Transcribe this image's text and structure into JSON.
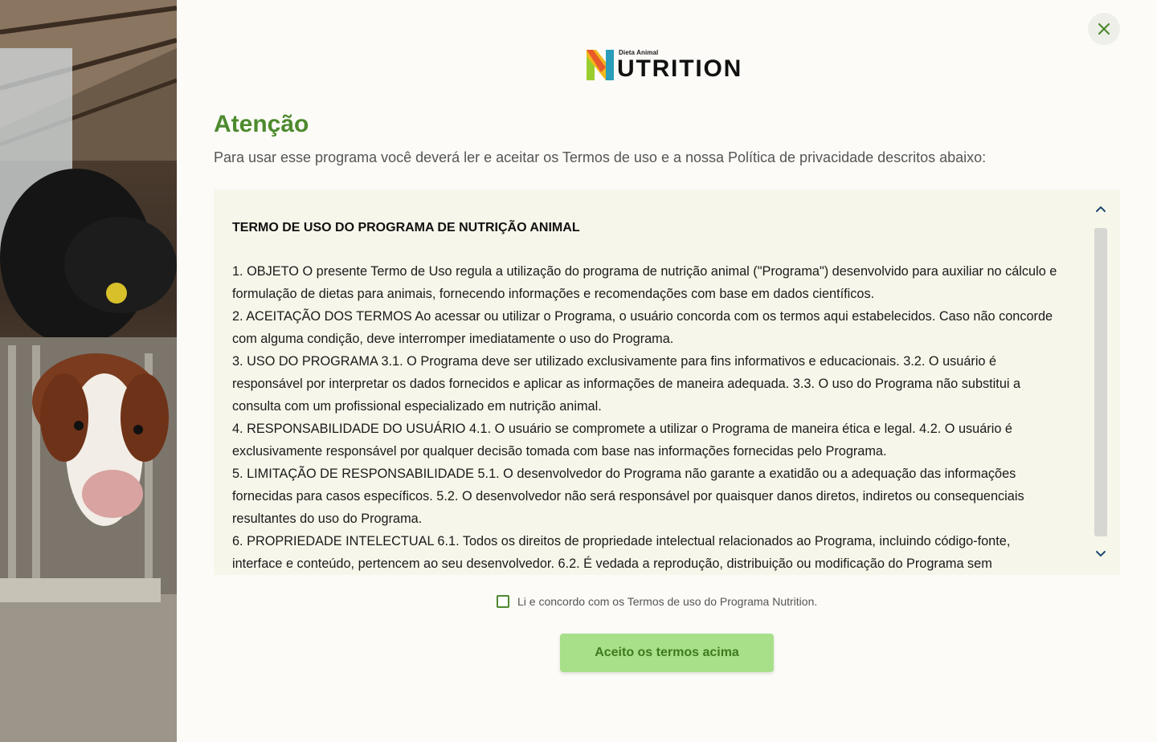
{
  "photo": {
    "alt_icon": "cows-in-barn-photo"
  },
  "header": {
    "close_icon": "close-icon",
    "logo_small": "Dieta Animal",
    "logo_word": "UTRITION",
    "logo_letter": "N"
  },
  "page": {
    "title": "Atenção",
    "subtitle": "Para usar esse programa você deverá ler e aceitar os Termos de uso e a nossa Política de privacidade descritos abaixo:"
  },
  "terms": {
    "heading": "TERMO DE USO DO PROGRAMA DE NUTRIÇÃO ANIMAL",
    "paragraphs": [
      "1. OBJETO O presente Termo de Uso regula a utilização do programa de nutrição animal (\"Programa\") desenvolvido para auxiliar no cálculo e formulação de dietas para animais, fornecendo informações e recomendações com base em dados científicos.",
      "2. ACEITAÇÃO DOS TERMOS Ao acessar ou utilizar o Programa, o usuário concorda com os termos aqui estabelecidos. Caso não concorde com alguma condição, deve interromper imediatamente o uso do Programa.",
      "3. USO DO PROGRAMA 3.1. O Programa deve ser utilizado exclusivamente para fins informativos e educacionais. 3.2. O usuário é responsável por interpretar os dados fornecidos e aplicar as informações de maneira adequada. 3.3. O uso do Programa não substitui a consulta com um profissional especializado em nutrição animal.",
      "4. RESPONSABILIDADE DO USUÁRIO 4.1. O usuário se compromete a utilizar o Programa de maneira ética e legal. 4.2. O usuário é exclusivamente responsável por qualquer decisão tomada com base nas informações fornecidas pelo Programa.",
      "5. LIMITAÇÃO DE RESPONSABILIDADE 5.1. O desenvolvedor do Programa não garante a exatidão ou a adequação das informações fornecidas para casos específicos. 5.2. O desenvolvedor não será responsável por quaisquer danos diretos, indiretos ou consequenciais resultantes do uso do Programa.",
      "6. PROPRIEDADE INTELECTUAL 6.1. Todos os direitos de propriedade intelectual relacionados ao Programa, incluindo código-fonte, interface e conteúdo, pertencem ao seu desenvolvedor. 6.2. É vedada a reprodução, distribuição ou modificação do Programa sem"
    ]
  },
  "agreement": {
    "checked": false,
    "label": "Li e concordo com os Termos de uso do Programa Nutrition."
  },
  "actions": {
    "accept_label": "Aceito os termos acima"
  },
  "colors": {
    "accent_green": "#4d8a2e",
    "button_bg": "#a8e08a",
    "terms_bg": "#f7f6ea"
  }
}
